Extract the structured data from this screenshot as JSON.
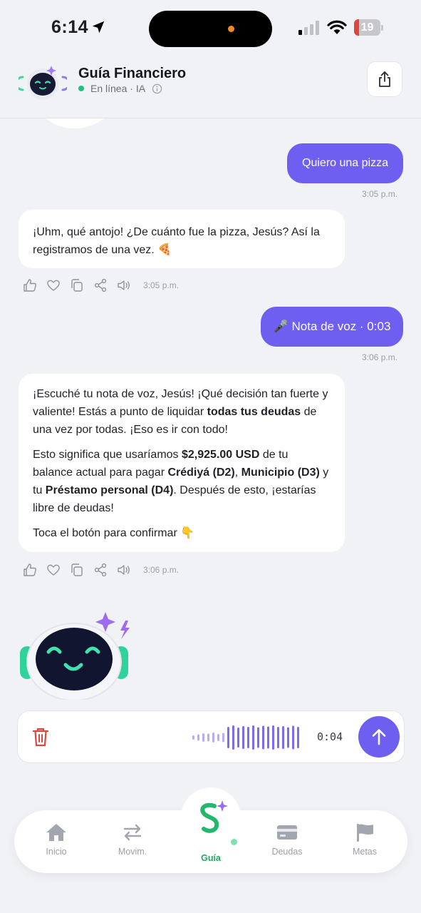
{
  "status_bar": {
    "time": "6:14",
    "battery": "19",
    "battery_level": 0.19
  },
  "header": {
    "title": "Guía Financiero",
    "status": "En línea · IA"
  },
  "chat": {
    "messages": [
      {
        "role": "user",
        "text": "Quiero una pizza",
        "time": "3:05 p.m."
      },
      {
        "role": "bot",
        "text": "¡Uhm, qué antojo! ¿De cuánto fue la pizza, Jesús? Así la registramos de una vez. 🍕",
        "time": "3:05 p.m."
      },
      {
        "role": "user",
        "text": "🎤 Nota de voz · 0:03",
        "time": "3:06 p.m."
      },
      {
        "role": "bot",
        "p1_a": "¡Escuché tu nota de voz, Jesús! ¡Qué decisión tan fuerte y valiente! Estás a punto de liquidar ",
        "p1_b": "todas tus deudas",
        "p1_c": " de una vez por todas. ¡Eso es ir con todo!",
        "p2_a": "Esto significa que usaríamos ",
        "p2_b": "$2,925.00 USD",
        "p2_c": " de tu balance actual para pagar ",
        "p2_d": "Crédiyá (D2)",
        "p2_e": ", ",
        "p2_f": "Municipio (D3)",
        "p2_g": " y tu ",
        "p2_h": "Préstamo personal (D4)",
        "p2_i": ". Después de esto, ¡estarías libre de deudas!",
        "p3": "Toca el botón para confirmar 👇",
        "time": "3:06 p.m."
      }
    ]
  },
  "voice_bar": {
    "duration": "0:04"
  },
  "tabs": [
    {
      "label": "Inicio"
    },
    {
      "label": "Movim."
    },
    {
      "label": "Guía"
    },
    {
      "label": "Deudas"
    },
    {
      "label": "Metas"
    }
  ],
  "colors": {
    "accent": "#6f5ff0",
    "online": "#22c07a",
    "brand_green": "#22a864",
    "danger": "#e0443e"
  },
  "icons": [
    "location-arrow-icon",
    "signal-icon",
    "wifi-icon",
    "battery-icon",
    "info-icon",
    "share-icon",
    "thumbs-up-icon",
    "heart-icon",
    "copy-icon",
    "share-nodes-icon",
    "speaker-icon",
    "trash-icon",
    "waveform-icon",
    "arrow-up-icon",
    "home-icon",
    "arrows-swap-icon",
    "guia-logo-icon",
    "card-icon",
    "flag-icon"
  ]
}
